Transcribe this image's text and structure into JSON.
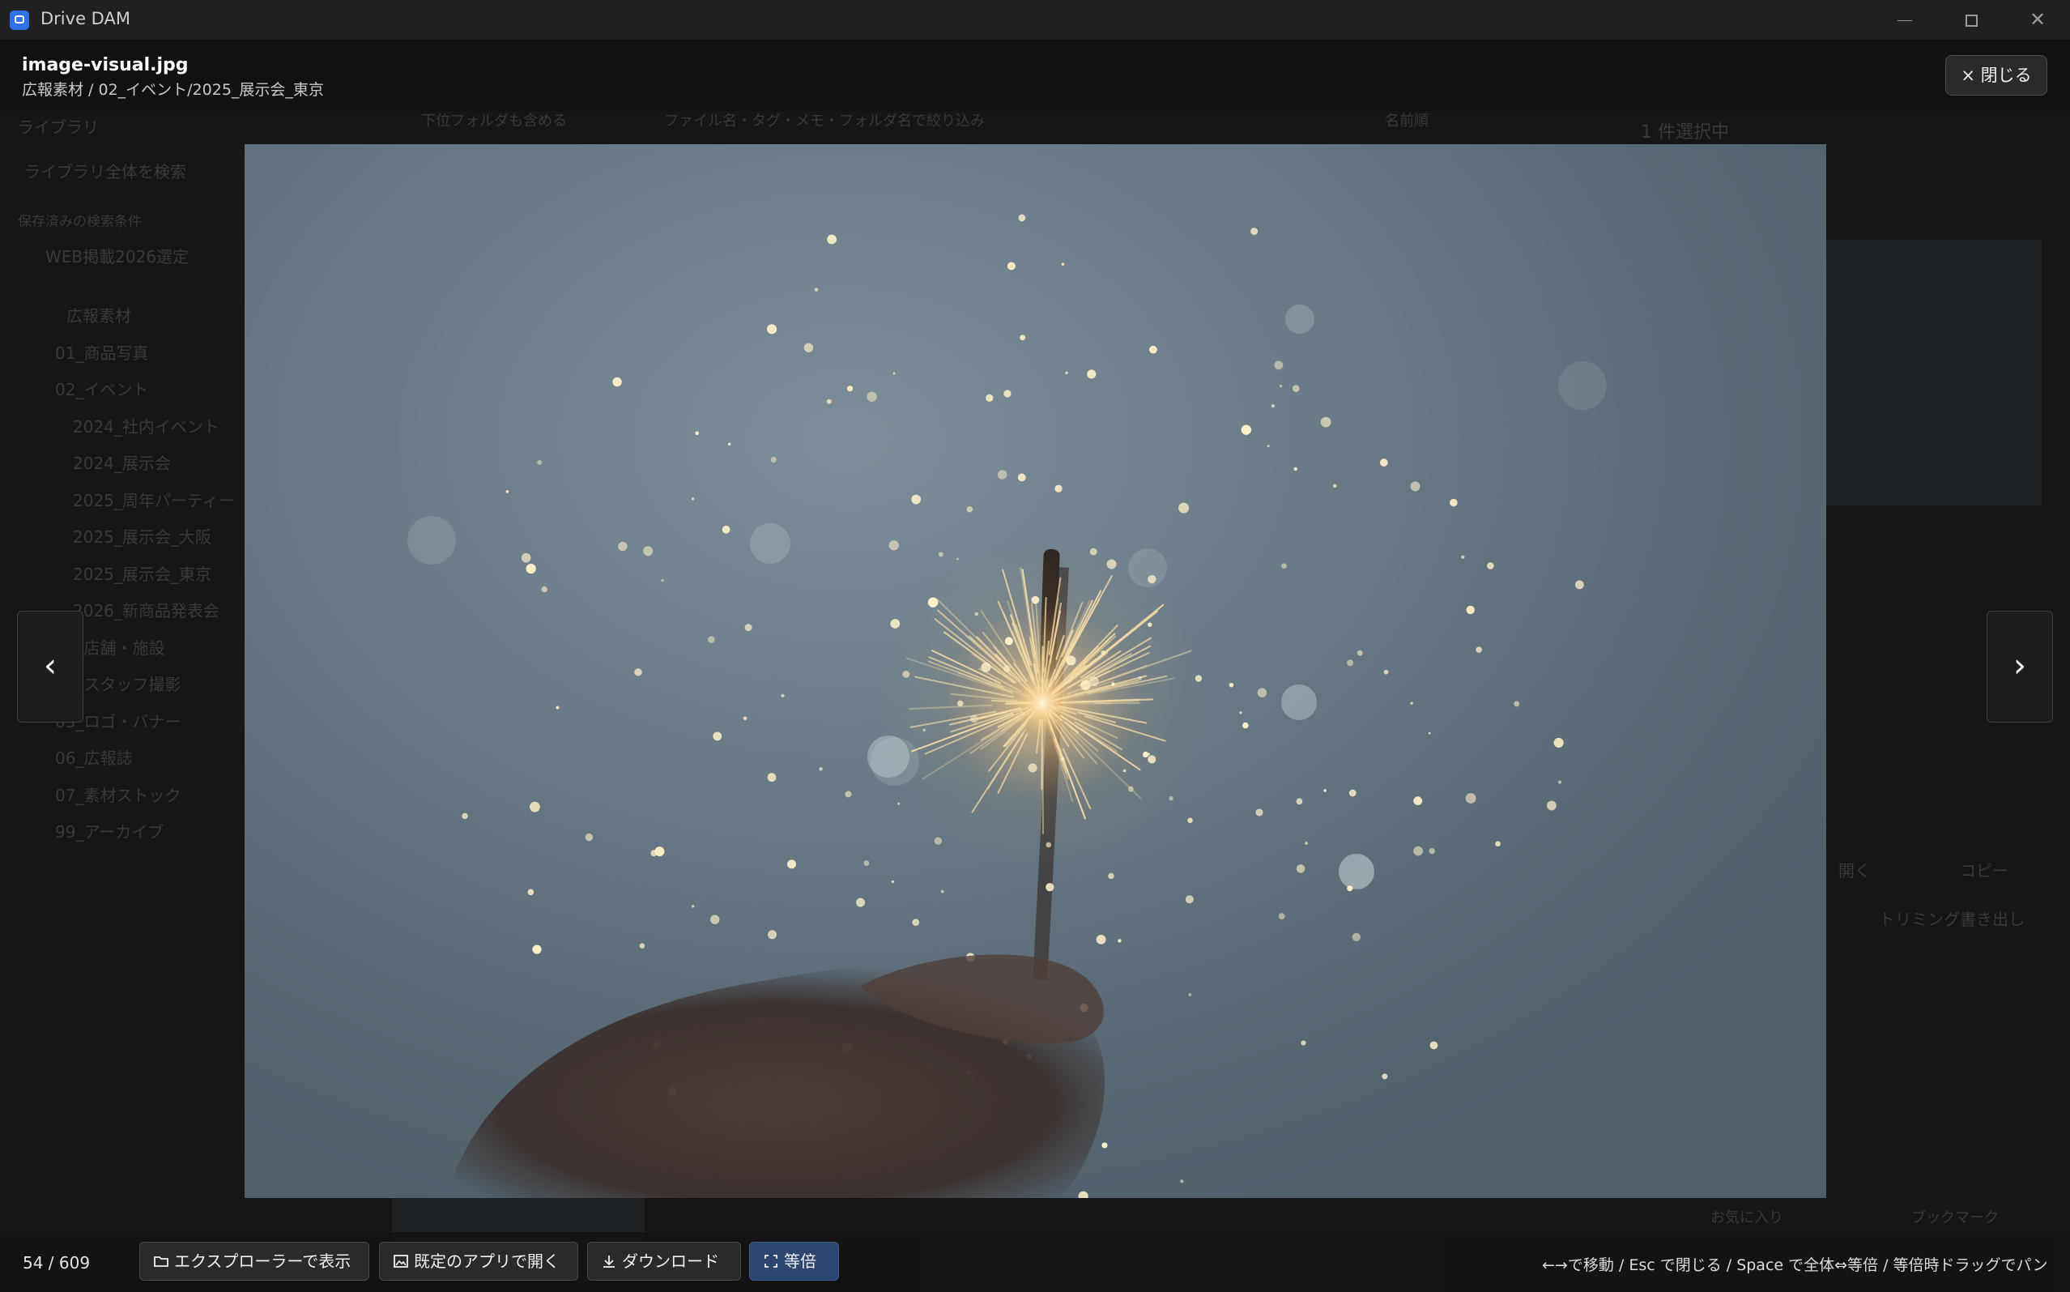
{
  "window": {
    "title": "Drive DAM",
    "minimize_icon": "minimize-icon",
    "maximize_icon": "maximize-icon",
    "close_icon": "close-icon"
  },
  "background_app": {
    "sidebar": {
      "title": "ライブラリ",
      "search_placeholder": "ライブラリ全体を検索",
      "saved_search_header": "保存済みの検索条件",
      "saved_search_item": "WEB掲載2026選定",
      "tree": [
        "広報素材",
        "01_商品写真",
        "02_イベント",
        "2024_社内イベント",
        "2024_展示会",
        "2025_周年パーティー",
        "2025_展示会_大阪",
        "2025_展示会_東京",
        "2026_新商品発表会",
        "03_店舗・施設",
        "04_スタッフ撮影",
        "05_ロゴ・バナー",
        "06_広報誌",
        "07_素材ストック",
        "99_アーカイブ"
      ]
    },
    "toolbar": {
      "subfolder_toggle": "下位フォルダも含める",
      "search_placeholder": "ファイル名・タグ・メモ・フォルダ名で絞り込み",
      "sort": "名前順"
    },
    "detail": {
      "selection_header": "1 件選択中",
      "open_button": "開く",
      "copy_button": "コピー",
      "trim_button": "トリミング書き出し",
      "favorite_button": "お気に入り",
      "bookmark_button": "ブックマーク"
    }
  },
  "viewer": {
    "file_name": "image-visual.jpg",
    "file_path": "広報素材 / 02_イベント/2025_展示会_東京",
    "close_label": "× 閉じる",
    "prev_icon": "chevron-left-icon",
    "next_icon": "chevron-right-icon",
    "prev_glyph": "‹",
    "next_glyph": "›",
    "counter": "54 / 609",
    "toolbar": {
      "explorer_label": "エクスプローラーで表示",
      "explorer_icon": "folder-icon",
      "open_app_label": "既定のアプリで開く",
      "open_app_icon": "image-icon",
      "download_label": "ダウンロード",
      "download_icon": "download-icon",
      "actual_size_label": "等倍",
      "actual_size_icon": "fullscreen-icon"
    },
    "shortcut_hint": "←→で移動 / Esc で閉じる / Space で全体⇔等倍 / 等倍時ドラッグでパン",
    "image_subject": "sparkler-photo"
  },
  "colors": {
    "accent": "#2f6fe8",
    "active_button": "#2d4670"
  }
}
